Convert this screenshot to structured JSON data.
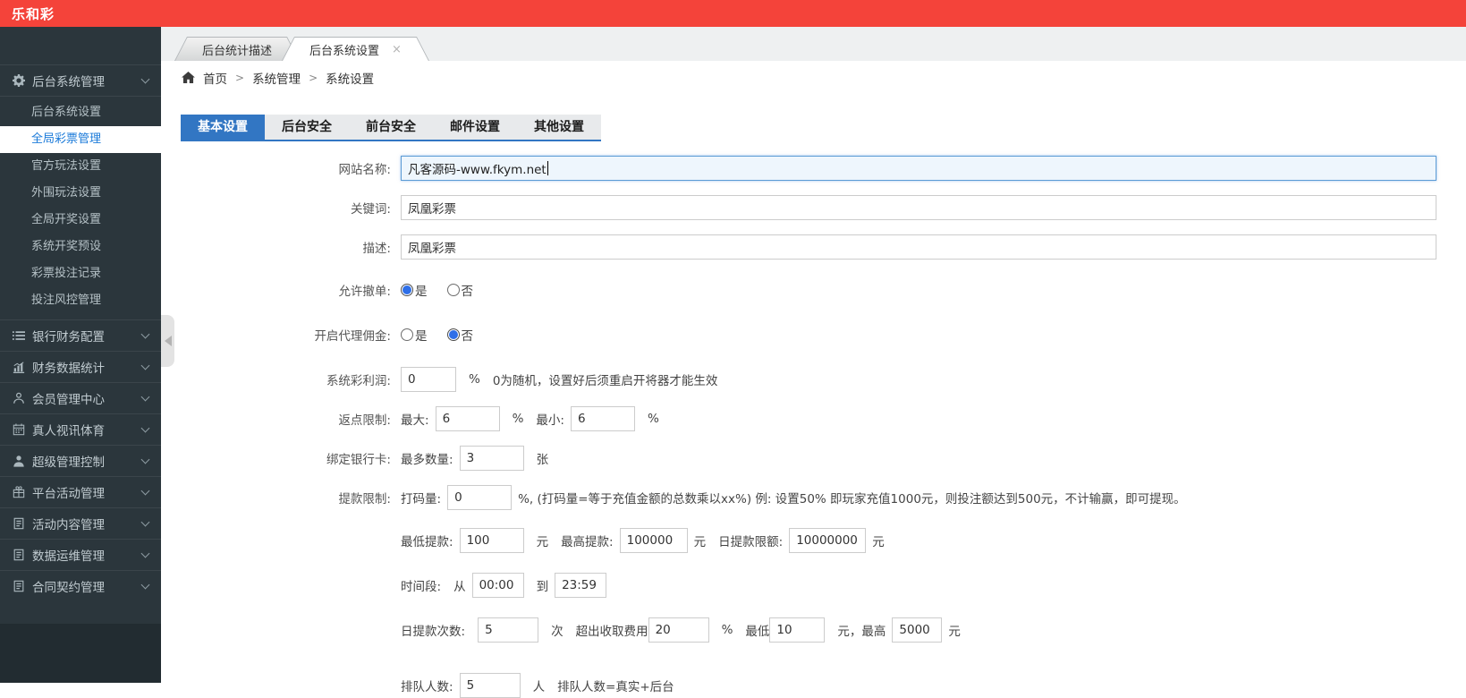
{
  "header": {
    "logo_text": "乐和彩",
    "bg_color": "#f4433a"
  },
  "window_tabs": {
    "inactive_label": "后台统计描述",
    "active_label": "后台系统设置",
    "close_glyph": "×"
  },
  "breadcrumb": {
    "home": "首页",
    "sep": ">",
    "level2": "系统管理",
    "level3": "系统设置"
  },
  "sidebar": {
    "expanded_section": {
      "label": "后台系统管理",
      "icon": "gear-icon"
    },
    "submenu": [
      {
        "label": "后台系统设置"
      },
      {
        "label": "全局彩票管理",
        "active": true
      },
      {
        "label": "官方玩法设置"
      },
      {
        "label": "外围玩法设置"
      },
      {
        "label": "全局开奖设置"
      },
      {
        "label": "系统开奖预设"
      },
      {
        "label": "彩票投注记录"
      },
      {
        "label": "投注风控管理"
      }
    ],
    "sections": [
      {
        "label": "银行财务配置",
        "icon": "list-icon"
      },
      {
        "label": "财务数据统计",
        "icon": "chart-icon"
      },
      {
        "label": "会员管理中心",
        "icon": "member-icon"
      },
      {
        "label": "真人视讯体育",
        "icon": "calendar-icon"
      },
      {
        "label": "超级管理控制",
        "icon": "admin-icon"
      },
      {
        "label": "平台活动管理",
        "icon": "gift-icon"
      },
      {
        "label": "活动内容管理",
        "icon": "document-icon"
      },
      {
        "label": "数据运维管理",
        "icon": "document-icon"
      },
      {
        "label": "合同契约管理",
        "icon": "document-icon"
      }
    ],
    "accent_colors": {
      "active_item_text": "#1b7ad9",
      "active_item_bg": "#ffffff"
    }
  },
  "settings_tabs": [
    {
      "label": "基本设置",
      "active": true
    },
    {
      "label": "后台安全"
    },
    {
      "label": "前台安全"
    },
    {
      "label": "邮件设置"
    },
    {
      "label": "其他设置"
    }
  ],
  "settings_accent": "#3276c3",
  "form": {
    "site_name": {
      "label": "网站名称:",
      "value": "凡客源码-www.fkym.net"
    },
    "keywords": {
      "label": "关键词:",
      "value": "凤凰彩票"
    },
    "description": {
      "label": "描述:",
      "value": "凤凰彩票"
    },
    "allow_cancel": {
      "label": "允许撤单:",
      "yes": "是",
      "no": "否",
      "selected": "yes"
    },
    "agent_commission": {
      "label": "开启代理佣金:",
      "yes": "是",
      "no": "否",
      "selected": "no"
    },
    "system_profit": {
      "label": "系统彩利润:",
      "value": "0",
      "unit": "%",
      "note": "0为随机，设置好后须重启开将器才能生效"
    },
    "rebate_limit": {
      "label": "返点限制:",
      "max_label": "最大:",
      "max_value": "6",
      "max_unit": "%",
      "min_label": "最小:",
      "min_value": "6",
      "min_unit": "%"
    },
    "bank_card": {
      "label": "绑定银行卡:",
      "qty_label": "最多数量:",
      "value": "3",
      "unit": "张"
    },
    "withdraw_limit": {
      "label": "提款限制:",
      "turnover_label": "打码量:",
      "value": "0",
      "note": "%, (打码量=等于充值金额的总数乘以xx%) 例: 设置50% 即玩家充值1000元，则投注额达到500元，不计输赢，即可提现。"
    },
    "withdraw_amounts": {
      "min_label": "最低提款:",
      "min_value": "100",
      "min_unit": "元",
      "max_label": "最高提款:",
      "max_value": "100000",
      "max_unit": "元",
      "daily_label": "日提款限额:",
      "daily_value": "10000000",
      "daily_unit": "元"
    },
    "time_range": {
      "label": "时间段:",
      "from_label": "从",
      "from_value": "00:00",
      "to_label": "到",
      "to_value": "23:59"
    },
    "daily_times": {
      "label": "日提款次数:",
      "value": "5",
      "unit": "次",
      "fee_label": "超出收取费用",
      "fee_value": "20",
      "fee_unit": "%",
      "fee_min_label": "最低",
      "fee_min_value": "10",
      "fee_min_mid": "元，最高",
      "fee_max_value": "5000",
      "fee_max_unit": "元"
    },
    "queue": {
      "label": "排队人数:",
      "value": "5",
      "unit": "人",
      "note": "排队人数=真实+后台"
    }
  }
}
